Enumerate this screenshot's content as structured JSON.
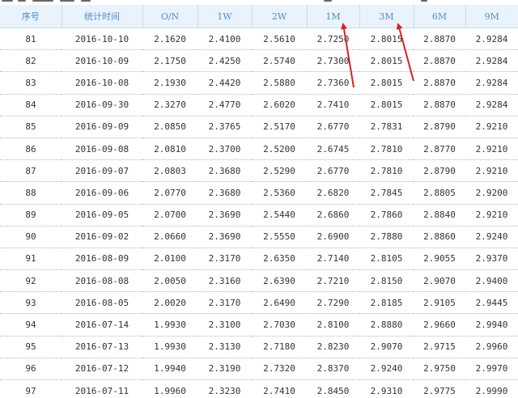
{
  "table": {
    "headers": [
      "序号",
      "统计时间",
      "O/N",
      "1W",
      "2W",
      "1M",
      "3M",
      "6M",
      "9M"
    ],
    "rows": [
      [
        "81",
        "2016-10-10",
        "2.1620",
        "2.4100",
        "2.5610",
        "2.7250",
        "2.8015",
        "2.8870",
        "2.9284"
      ],
      [
        "82",
        "2016-10-09",
        "2.1750",
        "2.4250",
        "2.5740",
        "2.7300",
        "2.8015",
        "2.8870",
        "2.9284"
      ],
      [
        "83",
        "2016-10-08",
        "2.1930",
        "2.4420",
        "2.5880",
        "2.7360",
        "2.8015",
        "2.8870",
        "2.9284"
      ],
      [
        "84",
        "2016-09-30",
        "2.3270",
        "2.4770",
        "2.6020",
        "2.7410",
        "2.8015",
        "2.8870",
        "2.9284"
      ],
      [
        "85",
        "2016-09-09",
        "2.0850",
        "2.3765",
        "2.5170",
        "2.6770",
        "2.7831",
        "2.8790",
        "2.9210"
      ],
      [
        "86",
        "2016-09-08",
        "2.0810",
        "2.3700",
        "2.5200",
        "2.6745",
        "2.7810",
        "2.8770",
        "2.9210"
      ],
      [
        "87",
        "2016-09-07",
        "2.0803",
        "2.3680",
        "2.5290",
        "2.6770",
        "2.7810",
        "2.8790",
        "2.9210"
      ],
      [
        "88",
        "2016-09-06",
        "2.0770",
        "2.3680",
        "2.5360",
        "2.6820",
        "2.7845",
        "2.8805",
        "2.9200"
      ],
      [
        "89",
        "2016-09-05",
        "2.0700",
        "2.3690",
        "2.5440",
        "2.6860",
        "2.7860",
        "2.8840",
        "2.9210"
      ],
      [
        "90",
        "2016-09-02",
        "2.0660",
        "2.3690",
        "2.5550",
        "2.6900",
        "2.7880",
        "2.8860",
        "2.9240"
      ],
      [
        "91",
        "2016-08-09",
        "2.0100",
        "2.3170",
        "2.6350",
        "2.7140",
        "2.8105",
        "2.9055",
        "2.9370"
      ],
      [
        "92",
        "2016-08-08",
        "2.0050",
        "2.3160",
        "2.6390",
        "2.7210",
        "2.8150",
        "2.9070",
        "2.9400"
      ],
      [
        "93",
        "2016-08-05",
        "2.0020",
        "2.3170",
        "2.6490",
        "2.7290",
        "2.8185",
        "2.9105",
        "2.9445"
      ],
      [
        "94",
        "2016-07-14",
        "1.9930",
        "2.3100",
        "2.7030",
        "2.8100",
        "2.8880",
        "2.9660",
        "2.9940"
      ],
      [
        "95",
        "2016-07-13",
        "1.9930",
        "2.3130",
        "2.7180",
        "2.8230",
        "2.9070",
        "2.9715",
        "2.9960"
      ],
      [
        "96",
        "2016-07-12",
        "1.9940",
        "2.3190",
        "2.7320",
        "2.8370",
        "2.9240",
        "2.9750",
        "2.9970"
      ],
      [
        "97",
        "2016-07-11",
        "1.9960",
        "2.3230",
        "2.7410",
        "2.8450",
        "2.9310",
        "2.9775",
        "2.9990"
      ]
    ]
  },
  "annotation": {
    "arrow_color": "#d92020"
  }
}
